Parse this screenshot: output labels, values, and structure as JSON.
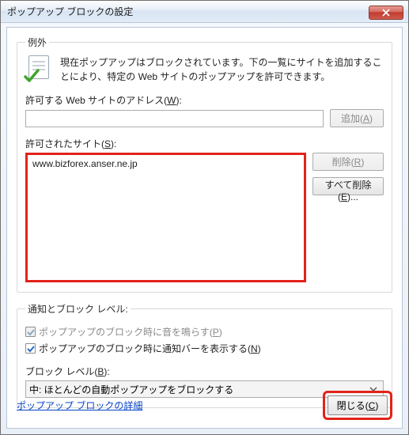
{
  "window": {
    "title": "ポップアップ ブロックの設定"
  },
  "exceptions": {
    "legend": "例外",
    "info": "現在ポップアップはブロックされています。下の一覧にサイトを追加することにより、特定の Web サイトのポップアップを許可できます。",
    "address_label_pre": "許可する Web サイトのアドレス(",
    "address_key": "W",
    "address_label_post": "):",
    "address_value": "",
    "add_btn_pre": "追加(",
    "add_btn_key": "A",
    "add_btn_post": ")",
    "allowed_label_pre": "許可されたサイト(",
    "allowed_key": "S",
    "allowed_label_post": "):",
    "allowed_sites": [
      "www.bizforex.anser.ne.jp"
    ],
    "remove_btn_pre": "削除(",
    "remove_btn_key": "R",
    "remove_btn_post": ")",
    "remove_all_pre": "すべて削除(",
    "remove_all_key": "E",
    "remove_all_post": ")..."
  },
  "notify": {
    "legend": "通知とブロック レベル:",
    "sound_pre": "ポップアップのブロック時に音を鳴らす(",
    "sound_key": "P",
    "sound_post": ")",
    "sound_checked": true,
    "sound_disabled": true,
    "bar_pre": "ポップアップのブロック時に通知バーを表示する(",
    "bar_key": "N",
    "bar_post": ")",
    "bar_checked": true,
    "level_label_pre": "ブロック レベル(",
    "level_key": "B",
    "level_label_post": "):",
    "level_value": "中: ほとんどの自動ポップアップをブロックする"
  },
  "footer": {
    "link": "ポップアップ ブロックの詳細",
    "close_pre": "閉じる(",
    "close_key": "C",
    "close_post": ")"
  }
}
